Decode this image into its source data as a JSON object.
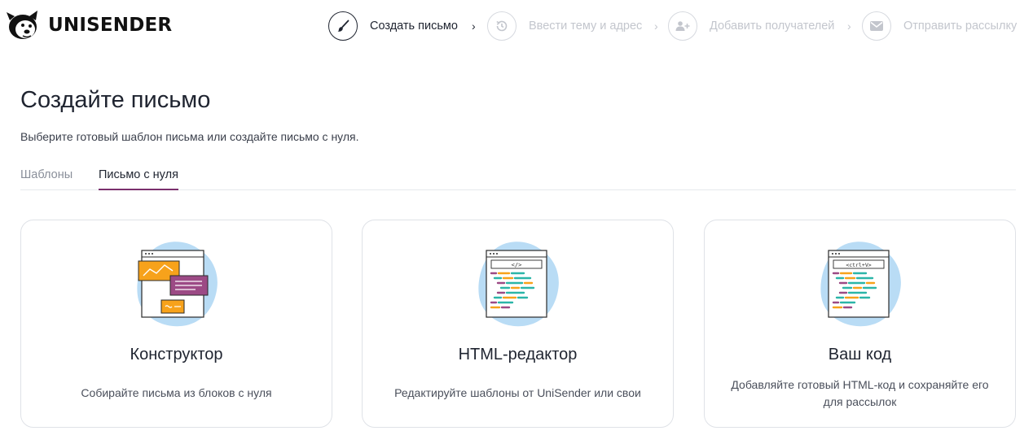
{
  "brand": {
    "name": "UNISENDER"
  },
  "steps": [
    {
      "label": "Создать письмо",
      "icon": "brush-icon",
      "active": true
    },
    {
      "label": "Ввести тему и адрес",
      "icon": "history-icon",
      "active": false
    },
    {
      "label": "Добавить получателей",
      "icon": "add-users-icon",
      "active": false
    },
    {
      "label": "Отправить рассылку",
      "icon": "envelope-icon",
      "active": false
    }
  ],
  "page": {
    "title": "Создайте письмо",
    "subtitle": "Выберите готовый шаблон письма или создайте письмо с нуля."
  },
  "tabs": [
    {
      "label": "Шаблоны",
      "active": false
    },
    {
      "label": "Письмо с нуля",
      "active": true
    }
  ],
  "cards": [
    {
      "title": "Конструктор",
      "description": "Собирайте письма из блоков с нуля",
      "icon": "builder-illustration"
    },
    {
      "title": "HTML-редактор",
      "description": "Редактируйте шаблоны от UniSender или свои",
      "icon": "html-editor-illustration",
      "tag": "</>"
    },
    {
      "title": "Ваш код",
      "description": "Добавляйте готовый HTML-код и сохраняйте его для рассылок",
      "icon": "code-illustration",
      "tag": "<ctrl+V>"
    }
  ],
  "colors": {
    "text": "#1f2430",
    "muted": "#c3c6cd",
    "tab_underline": "#7a2f6d",
    "illustration_blue": "#b9dcf5",
    "illustration_orange": "#f7a21b",
    "illustration_purple": "#9c4a85",
    "illustration_teal": "#2bb5a8"
  }
}
